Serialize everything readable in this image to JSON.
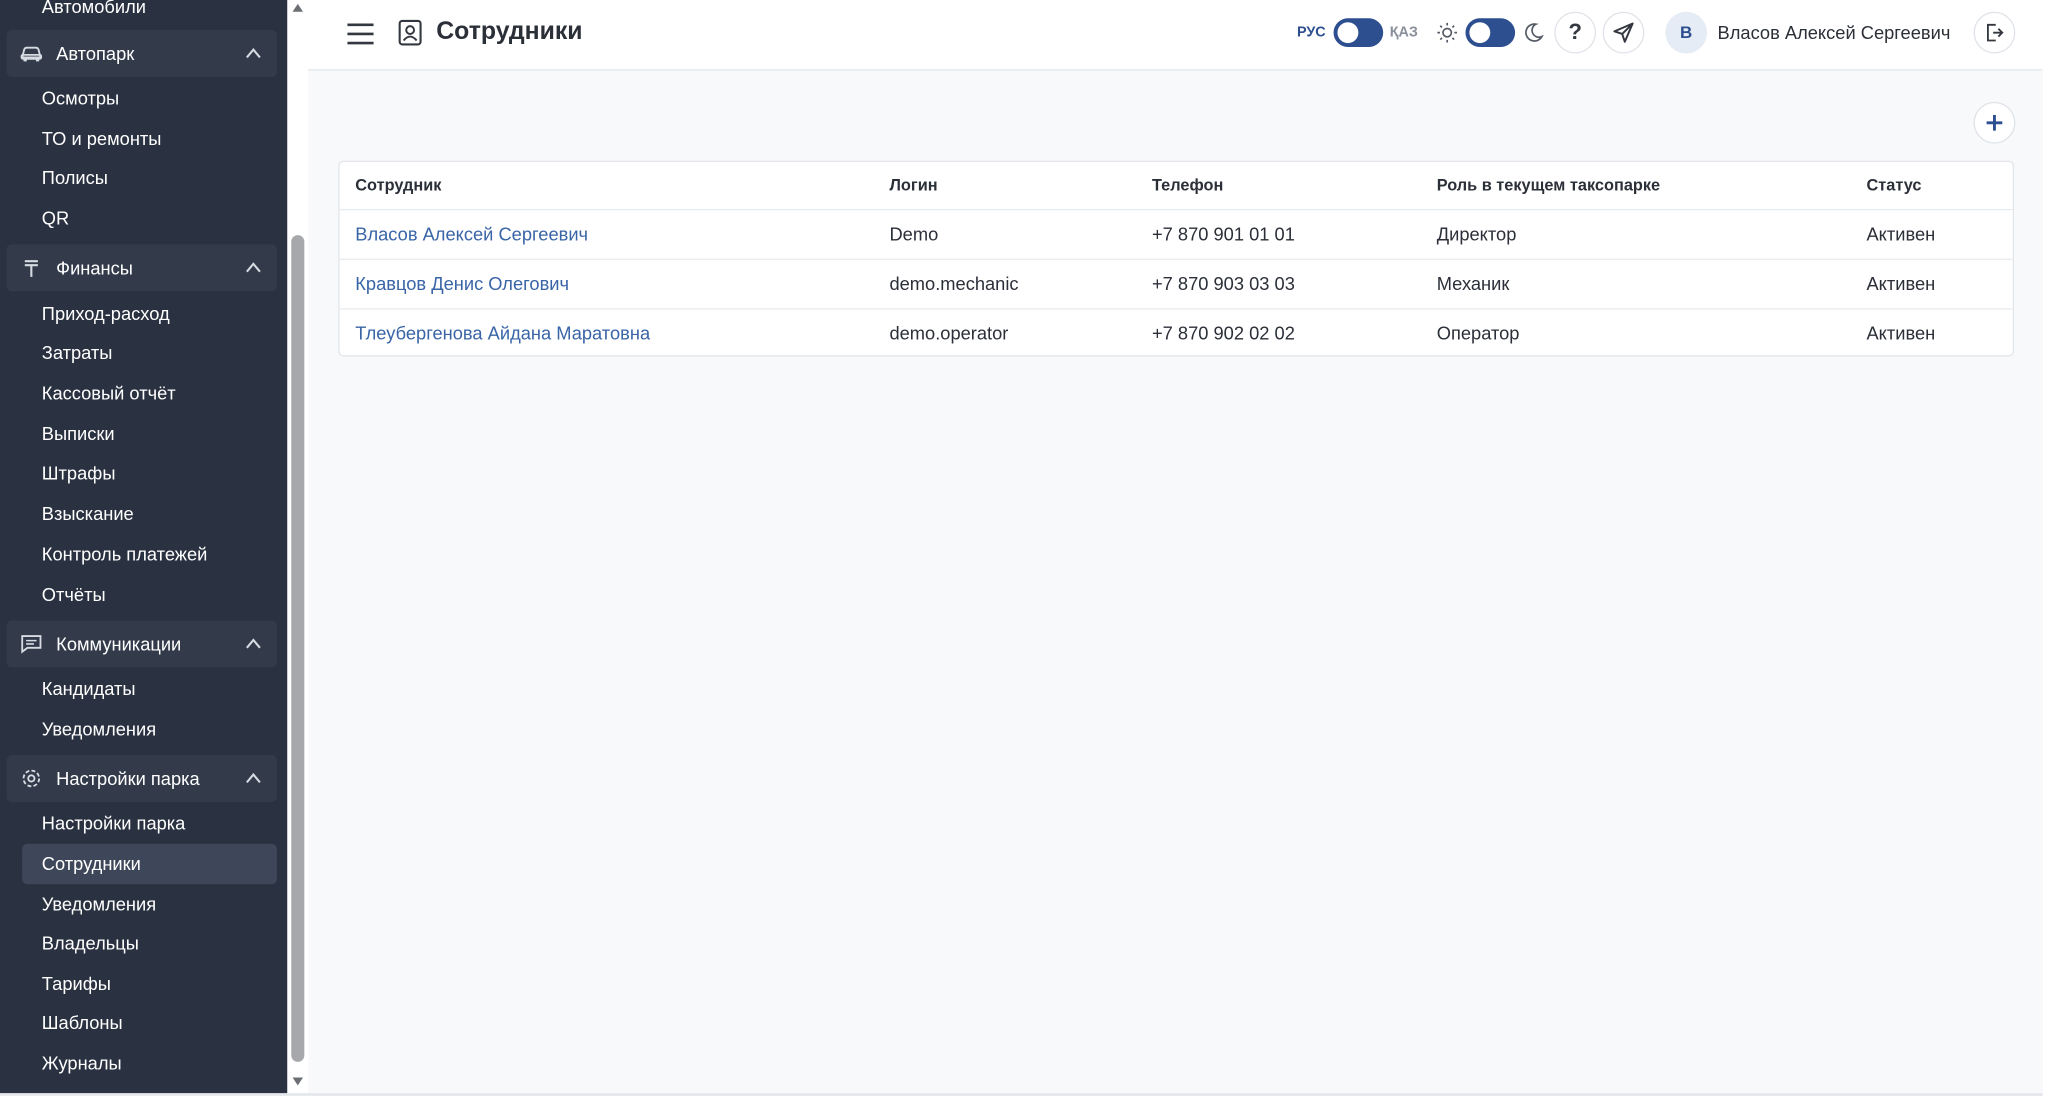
{
  "header": {
    "title": "Сотрудники",
    "lang_ru": "РУС",
    "lang_kz": "ҚАЗ",
    "help_label": "?",
    "avatar_initial": "В",
    "user_name": "Власов Алексей Сергеевич"
  },
  "sidebar": {
    "top_partial_item": "Автомобили",
    "groups": [
      {
        "label": "Автопарк",
        "icon": "car-icon",
        "items": [
          "Осмотры",
          "ТО и ремонты",
          "Полисы",
          "QR"
        ]
      },
      {
        "label": "Финансы",
        "icon": "tenge-icon",
        "items": [
          "Приход-расход",
          "Затраты",
          "Кассовый отчёт",
          "Выписки",
          "Штрафы",
          "Взыскание",
          "Контроль платежей",
          "Отчёты"
        ]
      },
      {
        "label": "Коммуникации",
        "icon": "chat-icon",
        "items": [
          "Кандидаты",
          "Уведомления"
        ]
      },
      {
        "label": "Настройки парка",
        "icon": "gear-icon",
        "items": [
          "Настройки парка",
          "Сотрудники",
          "Уведомления",
          "Владельцы",
          "Тарифы",
          "Шаблоны",
          "Журналы"
        ]
      }
    ],
    "active_item": "Сотрудники"
  },
  "table": {
    "columns": [
      "Сотрудник",
      "Логин",
      "Телефон",
      "Роль в текущем таксопарке",
      "Статус"
    ],
    "rows": [
      [
        "Власов Алексей Сергеевич",
        "Demo",
        "+7 870 901 01 01",
        "Директор",
        "Активен"
      ],
      [
        "Кравцов Денис Олегович",
        "demo.mechanic",
        "+7 870 903 03 03",
        "Механик",
        "Активен"
      ],
      [
        "Тлеубергенова Айдана Маратовна",
        "demo.operator",
        "+7 870 902 02 02",
        "Оператор",
        "Активен"
      ]
    ]
  },
  "colors": {
    "sidebar_bg": "#2a3140",
    "accent": "#2d4f8f",
    "link": "#3964a6"
  }
}
